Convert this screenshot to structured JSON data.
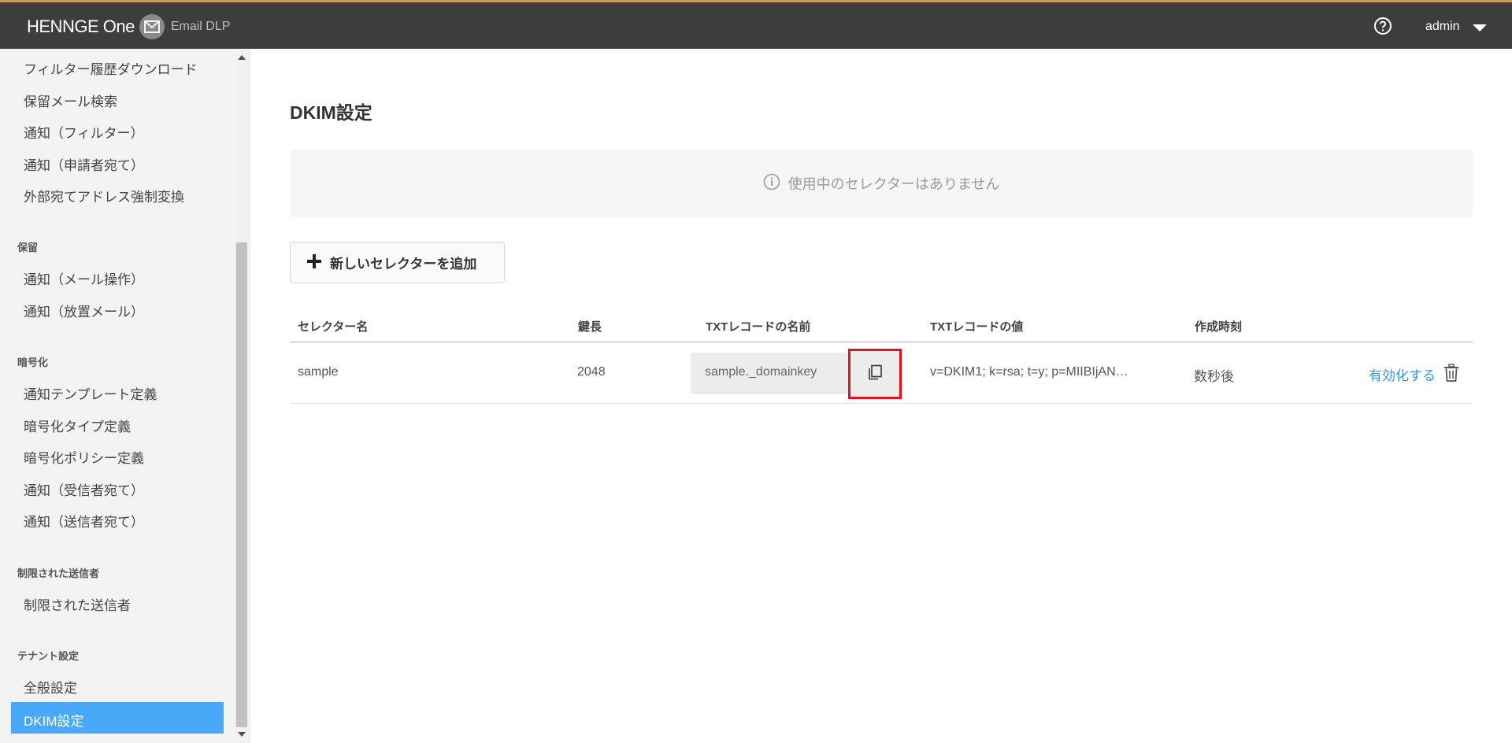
{
  "header": {
    "brand_name": "HENNGE One",
    "product_name": "Email DLP",
    "brand_icon": "mail-icon",
    "help_icon": "help-icon",
    "user_name": "admin"
  },
  "sidebar": {
    "items_top": [
      "フィルター履歴ダウンロード",
      "保留メール検索",
      "通知（フィルター）",
      "通知（申請者宛て）",
      "外部宛てアドレス強制変換"
    ],
    "groups": [
      {
        "title": "保留",
        "items": [
          "通知（メール操作）",
          "通知（放置メール）"
        ]
      },
      {
        "title": "暗号化",
        "items": [
          "通知テンプレート定義",
          "暗号化タイプ定義",
          "暗号化ポリシー定義",
          "通知（受信者宛て）",
          "通知（送信者宛て）"
        ]
      },
      {
        "title": "制限された送信者",
        "items": [
          "制限された送信者"
        ]
      },
      {
        "title": "テナント設定",
        "items": [
          "全般設定",
          "DKIM設定"
        ]
      }
    ],
    "active_item": "DKIM設定"
  },
  "main": {
    "title": "DKIM設定",
    "empty_message": "使用中のセレクターはありません",
    "add_button_label": "新しいセレクターを追加",
    "table": {
      "headers": [
        "セレクター名",
        "鍵長",
        "TXTレコードの名前",
        "TXTレコードの値",
        "作成時刻"
      ],
      "rows": [
        {
          "selector": "sample",
          "key_length": "2048",
          "txt_name": "sample._domainkey",
          "txt_value": "v=DKIM1; k=rsa; t=y; p=MIIBIjAN…",
          "created": "数秒後",
          "action_label": "有効化する"
        }
      ]
    }
  },
  "colors": {
    "header_bg": "#3d3d3d",
    "accent": "#4aa8f8",
    "link": "#2f96e8",
    "highlight": "#e0141e"
  }
}
